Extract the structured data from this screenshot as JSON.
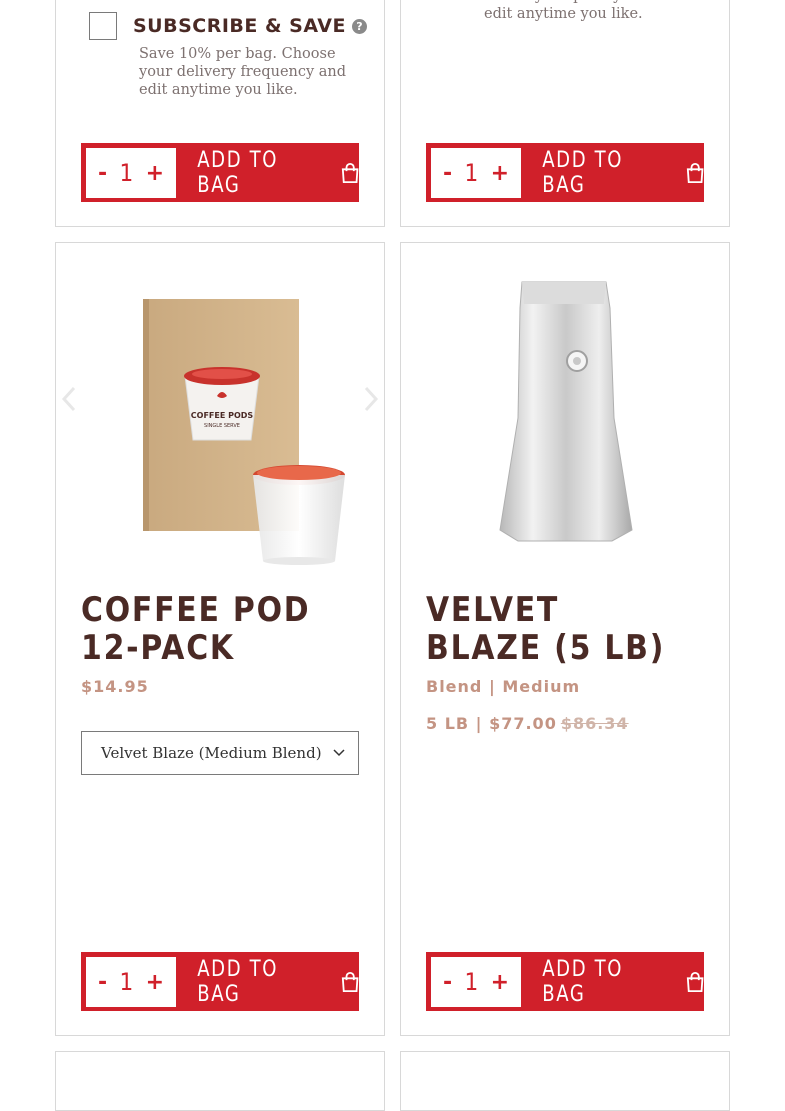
{
  "colors": {
    "brand_red": "#d0202a",
    "title_brown": "#4a2a25",
    "price_tan": "#c49483"
  },
  "top_left": {
    "subscribe_label": "Subscribe & Save",
    "description": "Save 10% per bag. Choose your delivery frequency and edit anytime you like.",
    "qty_minus": "-",
    "qty_value": "1",
    "qty_plus": "+",
    "add_label": "Add to bag"
  },
  "top_right": {
    "description": "delivery frequency and edit anytime you like.",
    "qty_minus": "-",
    "qty_value": "1",
    "qty_plus": "+",
    "add_label": "Add to bag"
  },
  "pod": {
    "title": "Coffee Pod 12-Pack",
    "price": "$14.95",
    "select_value": "Velvet Blaze (Medium Blend)",
    "pod_label_line1": "COFFEE PODS",
    "pod_label_line2": "SINGLE SERVE",
    "qty_minus": "-",
    "qty_value": "1",
    "qty_plus": "+",
    "add_label": "Add to bag"
  },
  "velvet": {
    "title": "Velvet Blaze (5 lb)",
    "subtitle": "Blend | Medium",
    "price_prefix": "5 LB | ",
    "price": "$77.00",
    "old_price": "$86.34",
    "qty_minus": "-",
    "qty_value": "1",
    "qty_plus": "+",
    "add_label": "Add to bag"
  }
}
